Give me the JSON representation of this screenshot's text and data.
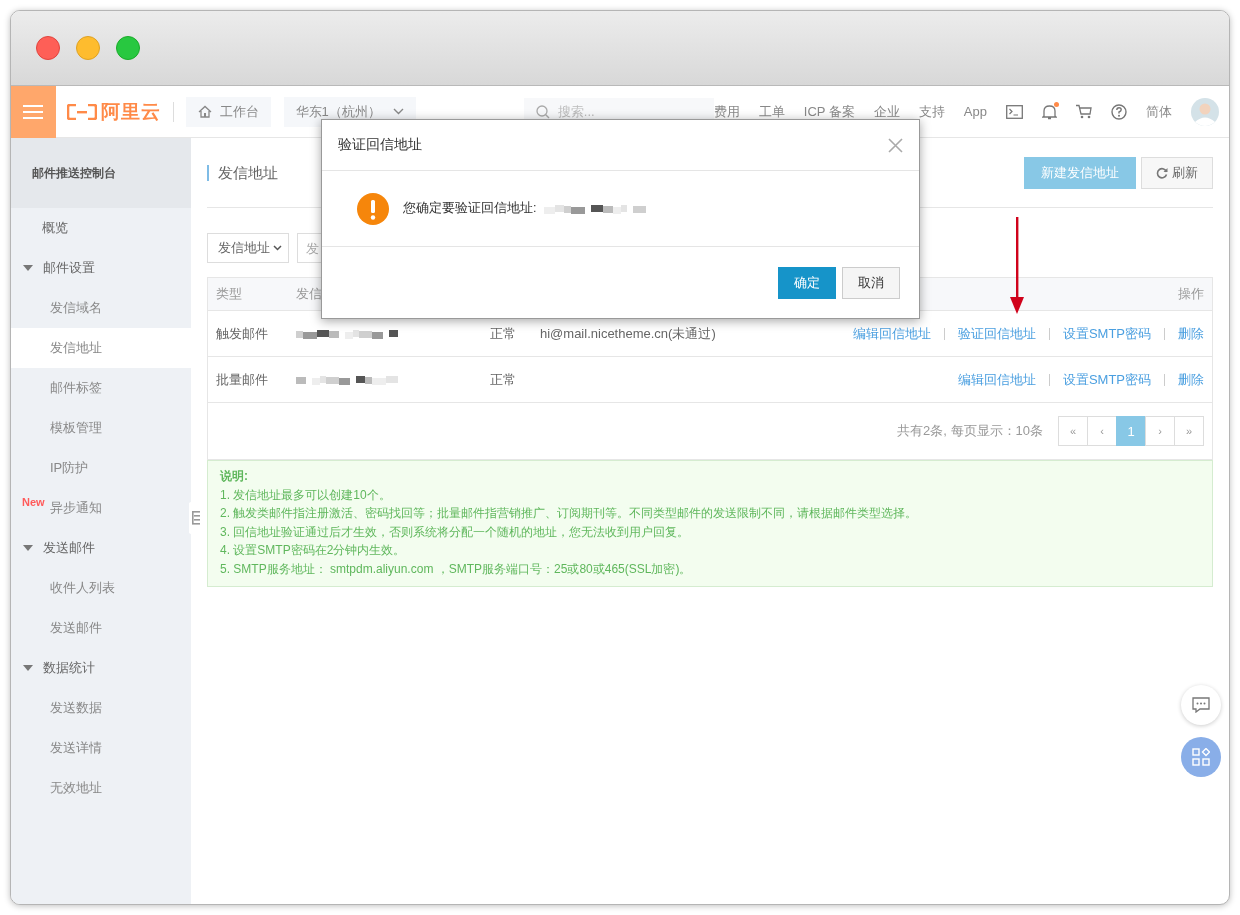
{
  "header": {
    "logo": "阿里云",
    "workbench": "工作台",
    "region": "华东1（杭州）",
    "search": {
      "placeholder": "搜索..."
    },
    "links": [
      "费用",
      "工单",
      "ICP 备案",
      "企业",
      "支持",
      "App"
    ],
    "notification_dot": true,
    "language": "简体"
  },
  "sidebar": {
    "title": "邮件推送控制台",
    "items": [
      {
        "label": "概览",
        "selected": false
      },
      {
        "label": "邮件设置",
        "expanded": true,
        "children": [
          {
            "label": "发信域名",
            "selected": false
          },
          {
            "label": "发信地址",
            "selected": true
          },
          {
            "label": "邮件标签",
            "selected": false
          },
          {
            "label": "模板管理",
            "selected": false
          },
          {
            "label": "IP防护",
            "selected": false
          },
          {
            "label": "异步通知",
            "selected": false,
            "badge": "New"
          }
        ]
      },
      {
        "label": "发送邮件",
        "expanded": true,
        "children": [
          {
            "label": "收件人列表",
            "selected": false
          },
          {
            "label": "发送邮件",
            "selected": false
          }
        ]
      },
      {
        "label": "数据统计",
        "expanded": true,
        "children": [
          {
            "label": "发送数据",
            "selected": false
          },
          {
            "label": "发送详情",
            "selected": false
          },
          {
            "label": "无效地址",
            "selected": false
          }
        ]
      }
    ]
  },
  "page": {
    "title": "发信地址",
    "buttons": [
      {
        "label": "新建发信地址",
        "kind": "primary"
      },
      {
        "label": "刷新",
        "kind": "refresh"
      }
    ]
  },
  "filter": {
    "select": "发信地址",
    "input": {
      "placeholder": "发"
    }
  },
  "table": {
    "columns": [
      "类型",
      "发信",
      "操作"
    ],
    "rows": [
      {
        "type": "触发邮件",
        "status": "正常",
        "reply_address": "hi@mail.nicetheme.cn(未通过)",
        "actions": [
          "编辑回信地址",
          "验证回信地址",
          "设置SMTP密码",
          "删除"
        ]
      },
      {
        "type": "批量邮件",
        "status": "正常",
        "actions": [
          "编辑回信地址",
          "设置SMTP密码",
          "删除"
        ]
      }
    ]
  },
  "pagination": {
    "summary": "共有2条, 每页显示：10条",
    "pages": [
      {
        "label": "«",
        "selected": false
      },
      {
        "label": "‹",
        "selected": false
      },
      {
        "label": "1",
        "selected": true
      },
      {
        "label": "›",
        "selected": false
      },
      {
        "label": "»",
        "selected": false
      }
    ]
  },
  "notice": {
    "title": "说明:",
    "lines": [
      "1. 发信地址最多可以创建10个。",
      "2. 触发类邮件指注册激活、密码找回等；批量邮件指营销推广、订阅期刊等。不同类型邮件的发送限制不同，请根据邮件类型选择。",
      "3. 回信地址验证通过后才生效，否则系统将分配一个随机的地址，您无法收到用户回复。",
      "4. 设置SMTP密码在2分钟内生效。",
      "5. SMTP服务地址： smtpdm.aliyun.com ，SMTP服务端口号：25或80或465(SSL加密)。"
    ]
  },
  "dialog": {
    "title": "验证回信地址",
    "message": "您确定要验证回信地址:",
    "buttons": [
      {
        "label": "确定",
        "kind": "primary"
      },
      {
        "label": "取消",
        "kind": "default"
      }
    ]
  }
}
